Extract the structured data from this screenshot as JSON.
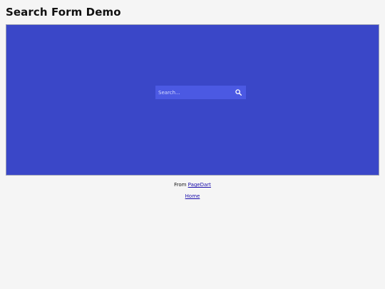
{
  "page": {
    "title": "Search Form Demo"
  },
  "panel": {
    "background": "#3a47c8"
  },
  "search": {
    "placeholder": "Search...",
    "value": "",
    "button_icon": "search-icon",
    "field_color": "#4b59e3"
  },
  "footer": {
    "from_label": "From",
    "source_link": "PageDart",
    "home_link": "Home"
  }
}
